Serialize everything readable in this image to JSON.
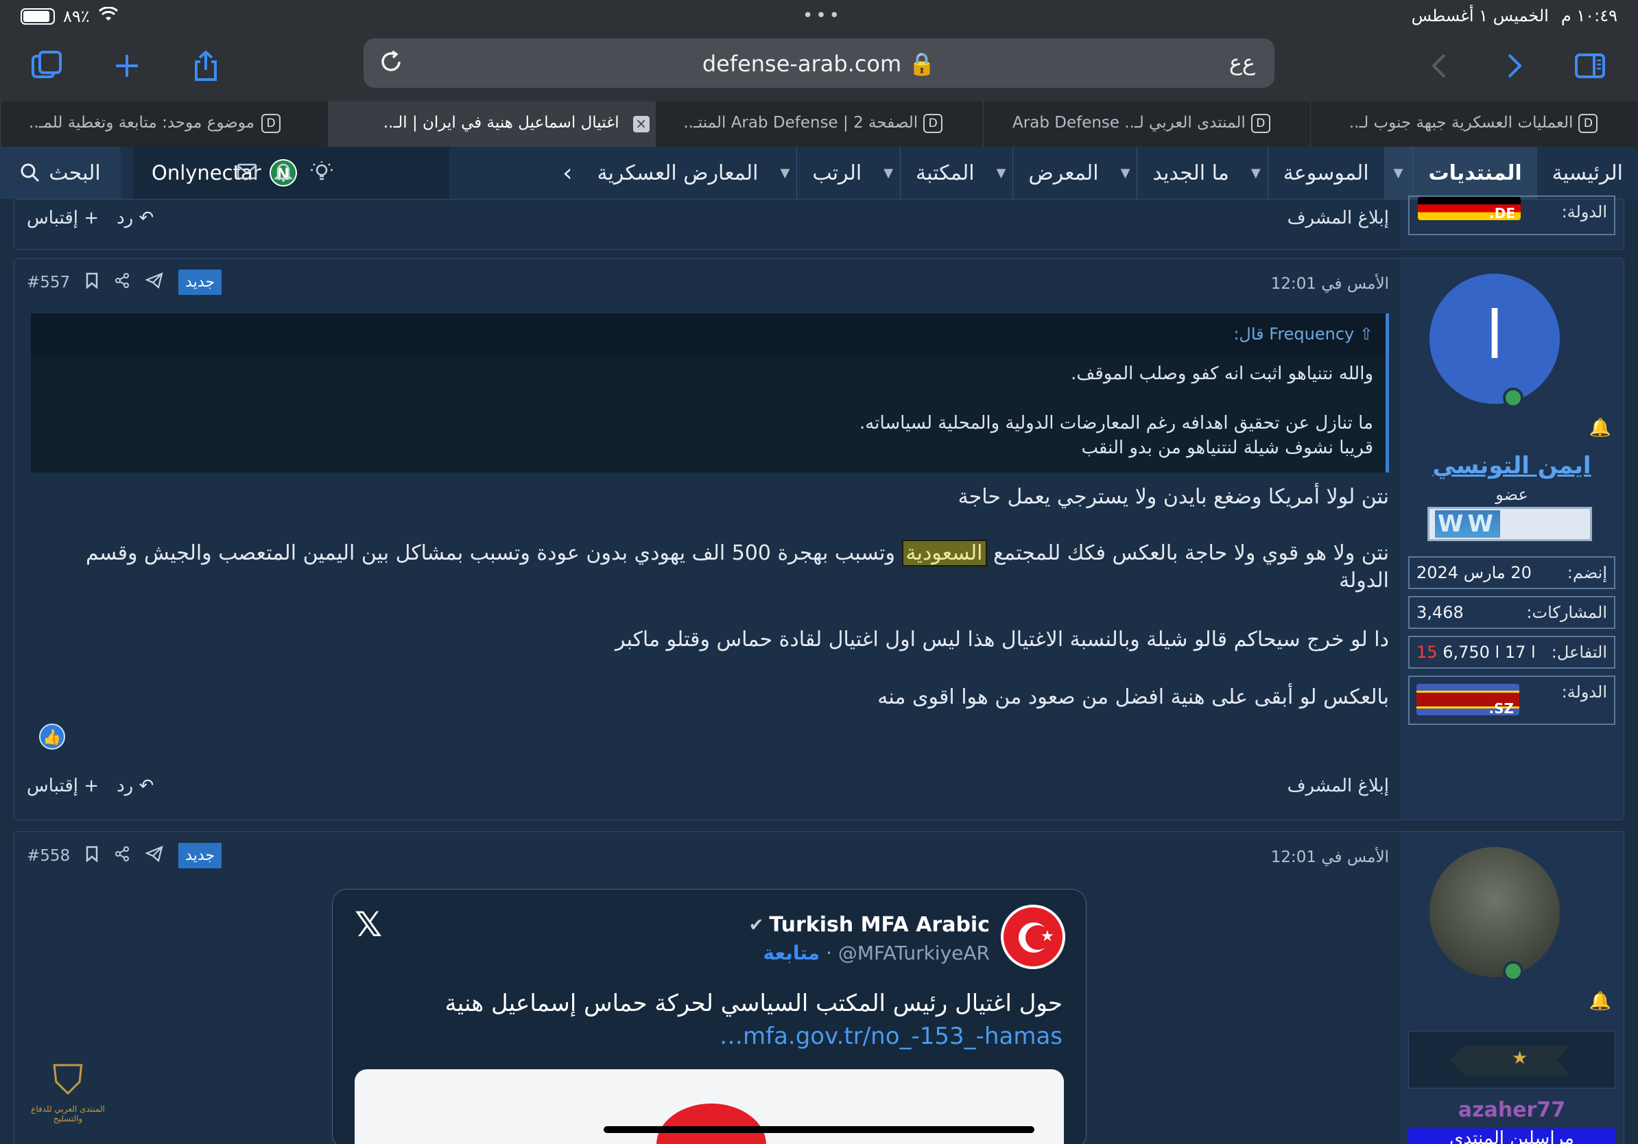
{
  "status": {
    "battery": "٨٩٪",
    "time": "١٠:٤٩ م",
    "date": "الخميس ١ أغسطس",
    "dots": "•••"
  },
  "browser": {
    "url": "defense-arab.com",
    "reader": "ﻉﻉ",
    "tabs": [
      {
        "title": "العمليات العسكرية جبهة جنوب لـ..",
        "active": false
      },
      {
        "title": "المنتدى العربي لـ.. Arab Defense",
        "active": false
      },
      {
        "title": "الصفحة 2 | Arab Defense المنتـ..",
        "active": false
      },
      {
        "title": "اغتيال اسماعيل هنية في ايران | الـ..",
        "active": true
      },
      {
        "title": "موضوع موحد: متابعة وتغطية للمـ..",
        "active": false
      }
    ],
    "favicon_letter": "D"
  },
  "nav": {
    "items": [
      {
        "label": "الرئيسية",
        "caret": false,
        "active": false
      },
      {
        "label": "المنتديات",
        "caret": true,
        "active": true
      },
      {
        "label": "الموسوعة",
        "caret": true,
        "active": false
      },
      {
        "label": "ما الجديد",
        "caret": true,
        "active": false
      },
      {
        "label": "المعرض",
        "caret": true,
        "active": false
      },
      {
        "label": "المكتبة",
        "caret": true,
        "active": false
      },
      {
        "label": "الرتب",
        "caret": true,
        "active": false
      },
      {
        "label": "المعارض العسكرية",
        "caret": false,
        "active": false
      }
    ],
    "username": "Onlynectar",
    "user_logo": "N",
    "search_label": "البحث"
  },
  "prev_post": {
    "report": "إبلاغ المشرف",
    "quote": "+ إقتباس",
    "reply": "رد"
  },
  "post557": {
    "date": "الأمس في 12:01",
    "badge": "جديد",
    "number": "#557",
    "quote_author": "Frequency قال:",
    "quote_lines": [
      "والله نتنياهو اثبت انه كفو وصلب الموقف.",
      "",
      "ما تنازل عن تحقيق اهدافه رغم المعارضات الدولية والمحلية لسياساته.",
      "قريبا نشوف شيلة لنتنياهو من بدو النقب"
    ],
    "p1": "نتن لولا أمريكا وضغع بايدن ولا يسترجي يعمل حاجة",
    "p2_before": "نتن ولا هو قوي ولا حاجة بالعكس فكك للمجتمع ",
    "p2_highlight": "السعودية",
    "p2_after": " وتسبب بهجرة 500 الف يهودي بدون عودة وتسبب بمشاكل بين اليمين المتعصب والجيش وقسم الدولة",
    "p3": "دا لو خرج سيحاكم قالو شيلة وبالنسبة الاغتيال هذا ليس اول اغتيال لقادة حماس وقتلو ماكبر",
    "p4": "بالعكس لو أبقى على هنية افضل من صعود من هوا اقوى منه",
    "report": "إبلاغ المشرف",
    "quote_btn": "+ إقتباس",
    "reply": "رد",
    "author": {
      "initial": "ا",
      "name": "ايمن التونسي",
      "role": "عضو",
      "rank_text": "WW",
      "joined_label": "إنضم:",
      "joined": "20 مارس 2024",
      "posts_label": "المشاركات:",
      "posts": "3,468",
      "react_label": "التفاعل:",
      "react_a": "6,750",
      "react_b": "17",
      "react_c": "15",
      "country_label": "الدولة:",
      "flag_code": ".SZ"
    },
    "prev_flag_code": ".DE",
    "prev_country_label": "الدولة:"
  },
  "post558": {
    "date": "الأمس في 12:01",
    "badge": "جديد",
    "number": "#558",
    "author": {
      "name": "azaher77",
      "role": "مراسلين المنتدى"
    },
    "tweet": {
      "name": "Turkish MFA Arabic",
      "handle": "@MFATurkiyeAR",
      "follow": "متابعة",
      "text": "حول اغتيال رئيس المكتب السياسي لحركة حماس إسماعيل هنية",
      "link": "mfa.gov.tr/no_-153_-hamas…"
    }
  },
  "watermark": "المنتدى العربي للدفاع والتسليح",
  "colors": {
    "accent": "#3d8cf5",
    "nav_bg": "#1c324b",
    "badge_new": "#2b74c5",
    "highlight": "#6b6b21",
    "react_red": "#ff3b3b"
  }
}
